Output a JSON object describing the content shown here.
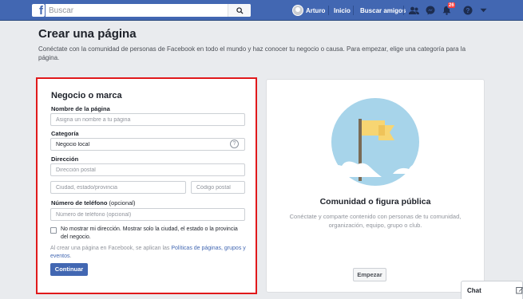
{
  "header": {
    "search_placeholder": "Buscar",
    "user_name": "Arturo",
    "home_label": "Inicio",
    "find_friends_label": "Buscar amigos",
    "notification_count": "26"
  },
  "page": {
    "title": "Crear una página",
    "description": "Conéctate con la comunidad de personas de Facebook en todo el mundo y haz conocer tu negocio o causa. Para empezar, elige una categoría para la página."
  },
  "form": {
    "title": "Negocio o marca",
    "page_name_label": "Nombre de la página",
    "page_name_placeholder": "Asigna un nombre a tu página",
    "category_label": "Categoría",
    "category_value": "Negocio local",
    "address_label": "Dirección",
    "address_placeholder": "Dirección postal",
    "city_placeholder": "Ciudad, estado/provincia",
    "postal_placeholder": "Código postal",
    "phone_label": "Número de teléfono",
    "phone_optional": "(opcional)",
    "phone_placeholder": "Número de teléfono (opcional)",
    "hide_address_text": "No mostrar mi dirección. Mostrar solo la ciudad, el estado o la provincia del negocio.",
    "policy_prefix": "Al crear una página en Facebook, se aplican las ",
    "policy_link": "Políticas de páginas, grupos y eventos",
    "policy_suffix": ".",
    "continue_label": "Continuar"
  },
  "card": {
    "title": "Comunidad o figura pública",
    "description": "Conéctate y comparte contenido con personas de tu comunidad, organización, equipo, grupo o club.",
    "start_label": "Empezar"
  },
  "chat": {
    "label": "Chat"
  },
  "colors": {
    "brand": "#4267b2",
    "highlight_border": "#e0191b",
    "flag": "#f7d572",
    "illustration_bg": "#a7d4ea"
  }
}
